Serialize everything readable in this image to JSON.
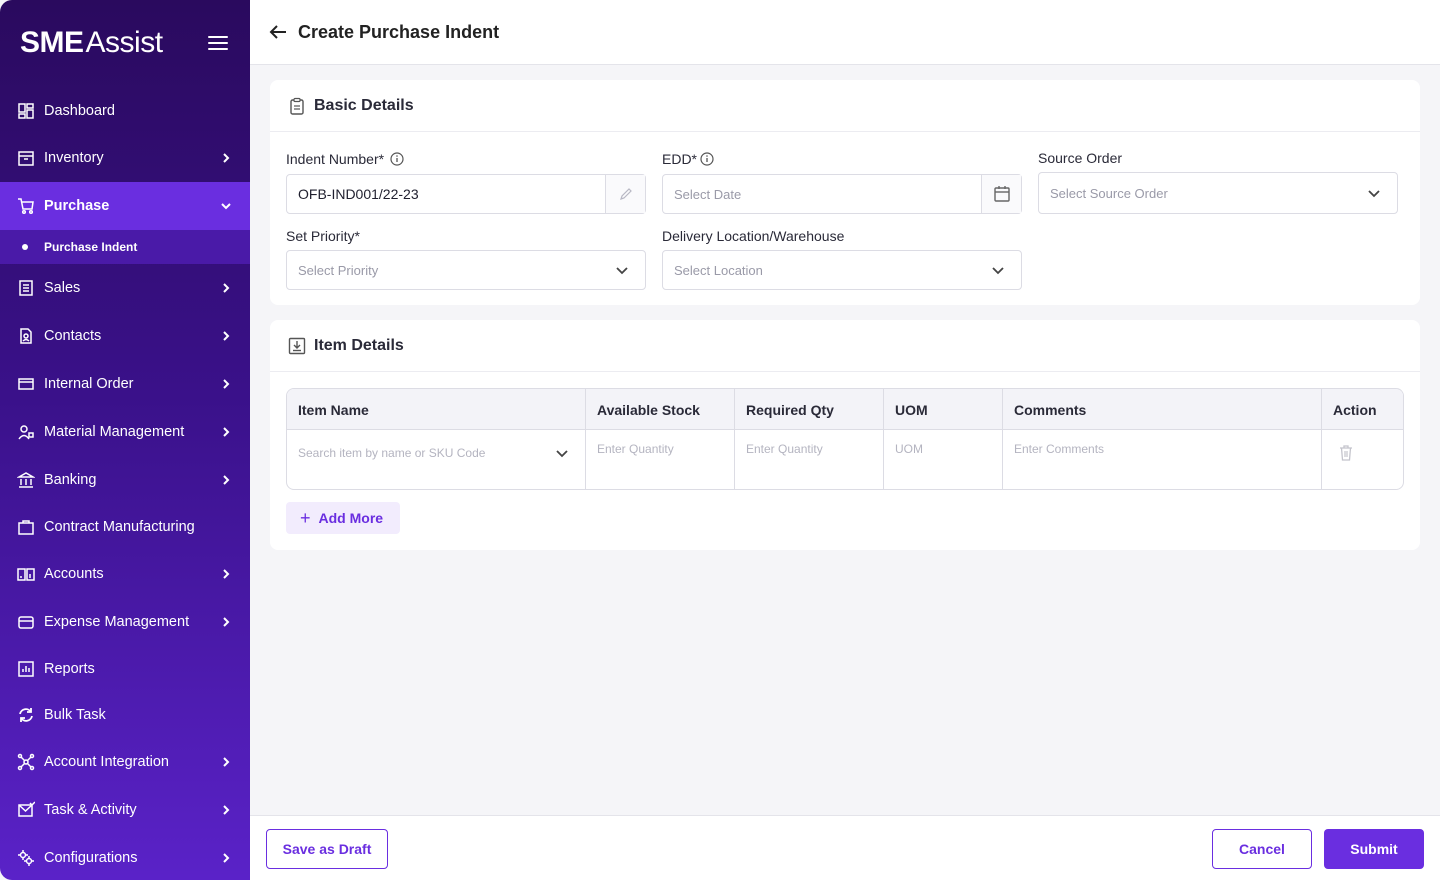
{
  "brand": {
    "part1": "SME",
    "part2": "Assist"
  },
  "sidebar": {
    "items": [
      {
        "label": "Dashboard",
        "icon": "dashboard-icon"
      },
      {
        "label": "Inventory",
        "icon": "inventory-icon"
      },
      {
        "label": "Purchase",
        "icon": "cart-icon"
      },
      {
        "label": "Sales",
        "icon": "sales-icon"
      },
      {
        "label": "Contacts",
        "icon": "contacts-icon"
      },
      {
        "label": "Internal Order",
        "icon": "internal-order-icon"
      },
      {
        "label": "Material Management",
        "icon": "material-icon"
      },
      {
        "label": "Banking",
        "icon": "bank-icon"
      },
      {
        "label": "Contract Manufacturing",
        "icon": "briefcase-icon"
      },
      {
        "label": "Accounts",
        "icon": "accounts-icon"
      },
      {
        "label": "Expense Management",
        "icon": "wallet-icon"
      },
      {
        "label": "Reports",
        "icon": "reports-icon"
      },
      {
        "label": "Bulk Task",
        "icon": "sync-icon"
      },
      {
        "label": "Account Integration",
        "icon": "integration-icon"
      },
      {
        "label": "Task & Activity",
        "icon": "mail-task-icon"
      },
      {
        "label": "Configurations",
        "icon": "config-icon"
      }
    ],
    "sub_item": "Purchase Indent"
  },
  "header": {
    "title": "Create Purchase Indent"
  },
  "basic": {
    "title": "Basic Details",
    "indent_label": "Indent Number*",
    "indent_value": "OFB-IND001/22-23",
    "edd_label": "EDD*",
    "edd_placeholder": "Select Date",
    "source_label": "Source Order",
    "source_placeholder": "Select Source Order",
    "priority_label": "Set Priority*",
    "priority_placeholder": "Select Priority",
    "location_label": "Delivery Location/Warehouse",
    "location_placeholder": "Select Location"
  },
  "items": {
    "title": "Item Details",
    "columns": [
      "Item Name",
      "Available Stock",
      "Required Qty",
      "UOM",
      "Comments",
      "Action"
    ],
    "row": {
      "item_placeholder": "Search item by name or SKU Code",
      "stock_placeholder": "Enter Quantity",
      "qty_placeholder": "Enter Quantity",
      "uom_placeholder": "UOM",
      "comments_placeholder": "Enter Comments"
    },
    "add_more": "Add More"
  },
  "footer": {
    "draft": "Save as Draft",
    "cancel": "Cancel",
    "submit": "Submit"
  },
  "colors": {
    "accent": "#6a2ee0",
    "sidebar_top": "#2a0a5e",
    "sidebar_bottom": "#5a22c8"
  }
}
